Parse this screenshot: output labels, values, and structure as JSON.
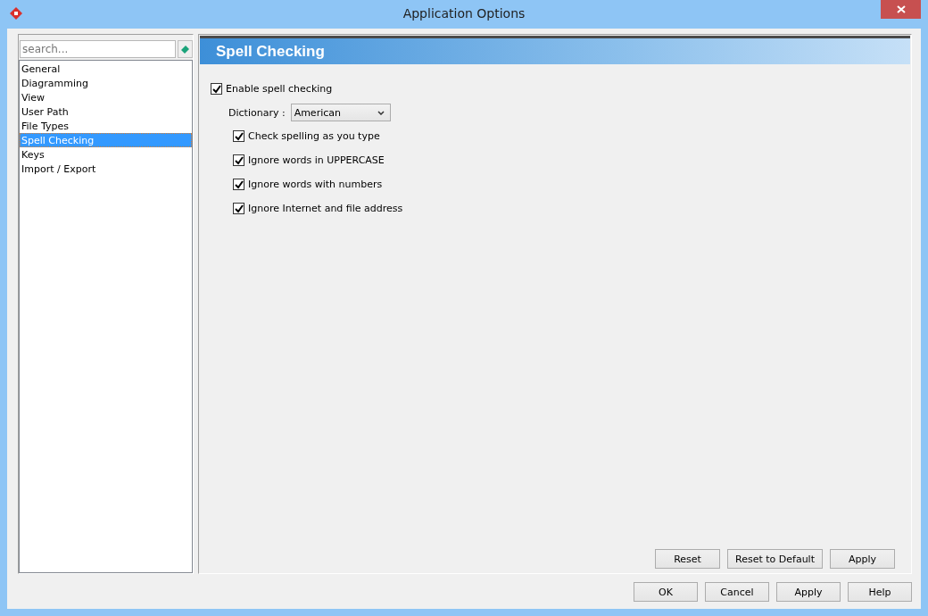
{
  "window": {
    "title": "Application Options"
  },
  "search": {
    "placeholder": "search..."
  },
  "sidebar": {
    "items": [
      {
        "label": "General",
        "selected": false
      },
      {
        "label": "Diagramming",
        "selected": false
      },
      {
        "label": "View",
        "selected": false
      },
      {
        "label": "User Path",
        "selected": false
      },
      {
        "label": "File Types",
        "selected": false
      },
      {
        "label": "Spell Checking",
        "selected": true
      },
      {
        "label": "Keys",
        "selected": false
      },
      {
        "label": "Import / Export",
        "selected": false
      }
    ]
  },
  "page": {
    "title": "Spell Checking",
    "enable": {
      "label": "Enable spell checking",
      "checked": true
    },
    "dictionary": {
      "label": "Dictionary :",
      "value": "American"
    },
    "options": [
      {
        "label": "Check spelling as you type",
        "checked": true
      },
      {
        "label": "Ignore words in UPPERCASE",
        "checked": true
      },
      {
        "label": "Ignore words with numbers",
        "checked": true
      },
      {
        "label": "Ignore Internet and file address",
        "checked": true
      }
    ],
    "buttons": [
      "Reset",
      "Reset to Default",
      "Apply"
    ]
  },
  "dialog_buttons": [
    "OK",
    "Cancel",
    "Apply",
    "Help"
  ]
}
